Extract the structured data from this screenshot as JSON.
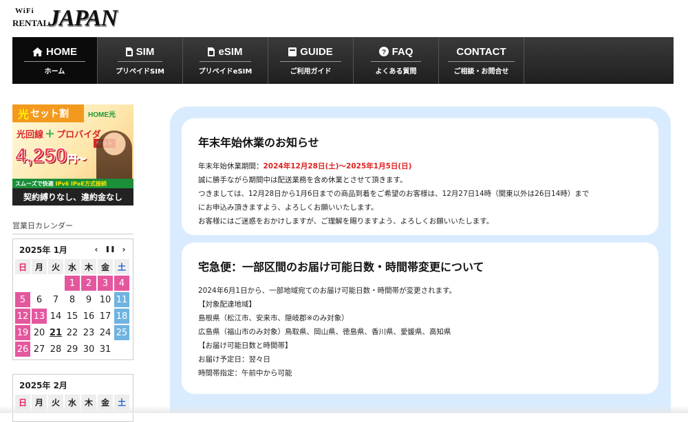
{
  "logo": {
    "wifi": "WiFi",
    "rental": "RENTAL",
    "japan": "JAPAN"
  },
  "nav": [
    {
      "label": "HOME",
      "sub": "ホーム",
      "icon": "home-icon"
    },
    {
      "label": "SIM",
      "sub": "プリペイドSIM",
      "icon": "sim-icon"
    },
    {
      "label": "eSIM",
      "sub": "プリペイドeSIM",
      "icon": "esim-icon"
    },
    {
      "label": "GUIDE",
      "sub": "ご利用ガイド",
      "icon": "book-icon"
    },
    {
      "label": "FAQ",
      "sub": "よくある質問",
      "icon": "question-icon"
    },
    {
      "label": "CONTACT",
      "sub": "ご相談・お問合せ",
      "icon": ""
    }
  ],
  "banner": {
    "tag": "セット割",
    "tag_hikari": "光",
    "home": "HOME光",
    "line2a": "光回線",
    "plus": "+",
    "line2b": "プロバイダ",
    "set": "セット",
    "price": "4,250",
    "price_unit": "円～",
    "speed": "スムーズで快適",
    "speed_b": "IPv6 IPoE方式接続",
    "noconst": "契約縛りなし、違約金なし"
  },
  "calendar": {
    "title": "営業日カレンダー",
    "dow": [
      "日",
      "月",
      "火",
      "水",
      "木",
      "金",
      "土"
    ],
    "months": [
      {
        "label": "2025年 1月",
        "days": [
          [
            "",
            "",
            "",
            "1",
            "2",
            "3",
            "4"
          ],
          [
            "5",
            "6",
            "7",
            "8",
            "9",
            "10",
            "11"
          ],
          [
            "12",
            "13",
            "14",
            "15",
            "16",
            "17",
            "18"
          ],
          [
            "19",
            "20",
            "21",
            "22",
            "23",
            "24",
            "25"
          ],
          [
            "26",
            "27",
            "28",
            "29",
            "30",
            "31",
            ""
          ]
        ]
      },
      {
        "label": "2025年 2月",
        "days": []
      }
    ],
    "controls": {
      "prev": "‹",
      "pause": "❚❚",
      "next": "›"
    }
  },
  "notices": [
    {
      "title": "年末年始休業のお知らせ",
      "period_label": "年末年始休業期間：",
      "period": "2024年12月28日(土)～2025年1月5日(日)",
      "lines": [
        "誠に勝手ながら期間中は配送業務を含め休業とさせて頂きます。",
        "つきましては、12月28日から1月6日までの商品到着をご希望のお客様は、12月27日14時（関東以外は26日14時）まで",
        "にお申込み頂きますよう、よろしくお願いいたします。",
        "お客様にはご迷惑をおかけしますが、ご理解を賜りますよう、よろしくお願いいたします。"
      ]
    },
    {
      "title": "宅急便：一部区間のお届け可能日数・時間帯変更について",
      "lines": [
        "2024年6月1日から、一部地域宛てのお届け可能日数・時間帯が変更されます。",
        "【対象配達地域】",
        "島根県（松江市、安来市、隠岐郡※のみ対象）",
        "広島県（福山市のみ対象）鳥取県、岡山県、徳島県、香川県、愛媛県、高知県",
        "【お届け可能日数と時間帯】",
        "お届け予定日：翌々日",
        "時間帯指定：午前中から可能"
      ]
    }
  ]
}
